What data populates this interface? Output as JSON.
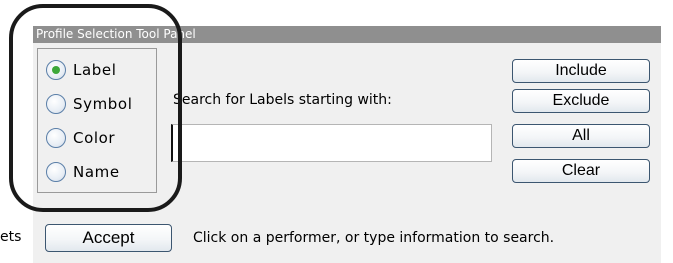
{
  "panel": {
    "title": "Profile Selection Tool Panel"
  },
  "left_edge_text": "ets",
  "radio_options": [
    {
      "label": "Label",
      "selected": true
    },
    {
      "label": "Symbol",
      "selected": false
    },
    {
      "label": "Color",
      "selected": false
    },
    {
      "label": "Name",
      "selected": false
    }
  ],
  "search": {
    "label": "Search for Labels starting with:",
    "value": ""
  },
  "buttons": {
    "include": "Include",
    "exclude": "Exclude",
    "all": "All",
    "clear": "Clear",
    "accept": "Accept"
  },
  "status_text": "Click on a performer, or type information to search.",
  "colors": {
    "titlebar": "#8f8f8f",
    "panel_bg": "#f0f0f0",
    "radio_selected": "#3da83a",
    "button_border": "#3c5670",
    "annotation_ring": "#1a1a1a"
  }
}
